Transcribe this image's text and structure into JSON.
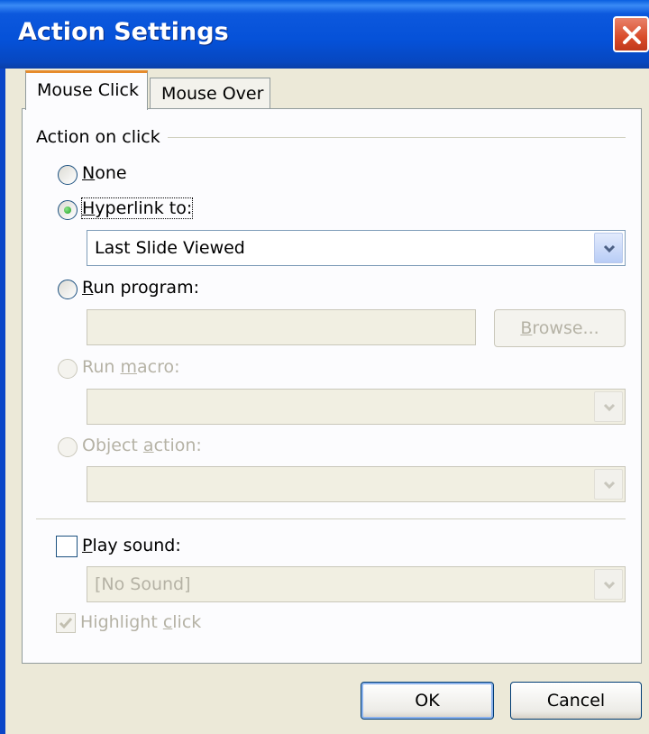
{
  "window": {
    "title": "Action Settings"
  },
  "tabs": [
    {
      "label": "Mouse Click",
      "active": true
    },
    {
      "label": "Mouse Over",
      "active": false
    }
  ],
  "action_group": {
    "label": "Action on click"
  },
  "options": {
    "none": {
      "label": "None",
      "selected": false,
      "enabled": true
    },
    "hyperlink": {
      "label": "Hyperlink to:",
      "selected": true,
      "enabled": true,
      "value": "Last Slide Viewed"
    },
    "run_program": {
      "label": "Run program:",
      "selected": false,
      "enabled": true,
      "value": "",
      "browse_label": "Browse..."
    },
    "run_macro": {
      "label": "Run macro:",
      "selected": false,
      "enabled": false,
      "value": ""
    },
    "object_action": {
      "label": "Object action:",
      "selected": false,
      "enabled": false,
      "value": ""
    }
  },
  "sound": {
    "label": "Play sound:",
    "checked": false,
    "value": "[No Sound]"
  },
  "highlight": {
    "label": "Highlight click",
    "checked": true,
    "enabled": false
  },
  "buttons": {
    "ok": "OK",
    "cancel": "Cancel"
  },
  "colors": {
    "title_bar": "#0551d8",
    "close_button": "#d94b2a",
    "dialog_bg": "#ece9d8",
    "active_tab_accent": "#e68b2c"
  }
}
